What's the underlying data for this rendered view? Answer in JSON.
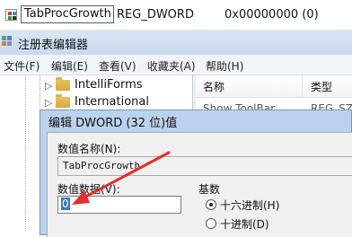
{
  "value_row": {
    "name": "TabProcGrowth",
    "type": "REG_DWORD",
    "data": "0x00000000 (0)"
  },
  "window": {
    "title": "注册表编辑器",
    "menu": [
      "文件(F)",
      "编辑(E)",
      "查看(V)",
      "收藏夹(A)",
      "帮助(H)"
    ]
  },
  "tree": {
    "nodes": [
      "IntelliForms",
      "International"
    ]
  },
  "list": {
    "col_name": "名称",
    "col_type": "类型",
    "row1_name": "Show ToolBar",
    "row1_type": "REG_SZ"
  },
  "dialog": {
    "title": "编辑 DWORD (32 位)值",
    "name_label": "数值名称(N):",
    "name_value": "TabProcGrowth",
    "data_label": "数值数据(V):",
    "data_value": "0",
    "base_label": "基数",
    "radio_hex": "十六进制(H)",
    "radio_dec": "十进制(D)"
  },
  "colors": {
    "annotation_arrow": "#e0302a",
    "selection": "#3875d7"
  }
}
